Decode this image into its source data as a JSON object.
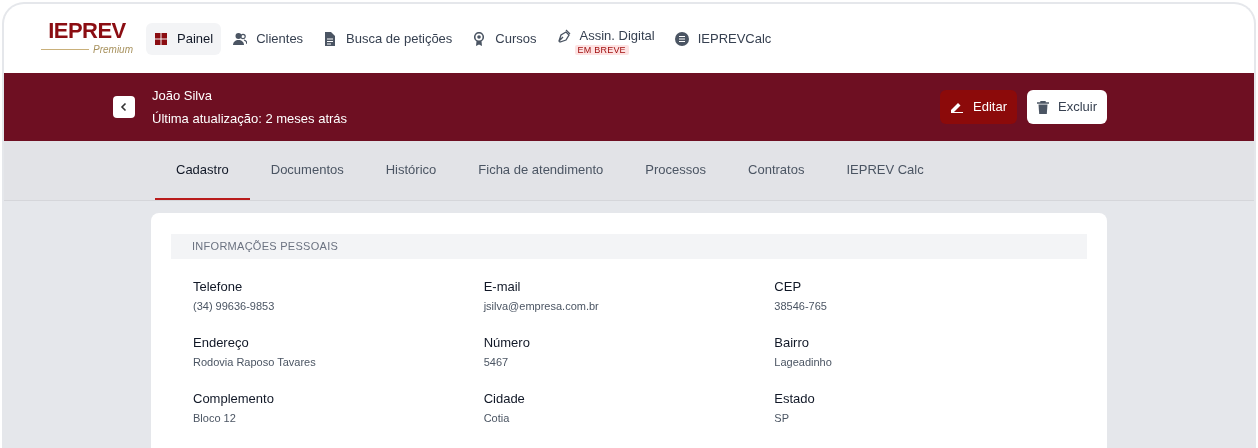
{
  "logo": {
    "title": "IEPREV",
    "subtitle": "Premium"
  },
  "nav": [
    {
      "label": "Painel",
      "selected": true
    },
    {
      "label": "Clientes",
      "selected": false
    },
    {
      "label": "Busca de petições",
      "selected": false
    },
    {
      "label": "Cursos",
      "selected": false
    },
    {
      "label": "Assin. Digital",
      "selected": false,
      "badge": "EM BREVE"
    },
    {
      "label": "IEPREVCalc",
      "selected": false
    }
  ],
  "header": {
    "name": "João Silva",
    "updated": "Última atualização: 2 meses atrás",
    "buttons": [
      {
        "label": "Editar",
        "kind": "primary"
      },
      {
        "label": "Excluir",
        "kind": "secondary"
      }
    ]
  },
  "tabs": [
    {
      "label": "Cadastro",
      "selected": true
    },
    {
      "label": "Documentos",
      "selected": false
    },
    {
      "label": "Histórico",
      "selected": false
    },
    {
      "label": "Ficha de atendimento",
      "selected": false
    },
    {
      "label": "Processos",
      "selected": false
    },
    {
      "label": "Contratos",
      "selected": false
    },
    {
      "label": "IEPREV Calc",
      "selected": false
    }
  ],
  "section": {
    "title": "INFORMAÇÕES PESSOAIS",
    "fields": [
      {
        "label": "Telefone",
        "value": "(34) 99636-9853"
      },
      {
        "label": "E-mail",
        "value": "jsilva@empresa.com.br"
      },
      {
        "label": "CEP",
        "value": "38546-765"
      },
      {
        "label": "Endereço",
        "value": "Rodovia Raposo Tavares"
      },
      {
        "label": "Número",
        "value": "5467"
      },
      {
        "label": "Bairro",
        "value": "Lageadinho"
      },
      {
        "label": "Complemento",
        "value": "Bloco 12"
      },
      {
        "label": "Cidade",
        "value": "Cotia"
      },
      {
        "label": "Estado",
        "value": "SP"
      }
    ]
  }
}
